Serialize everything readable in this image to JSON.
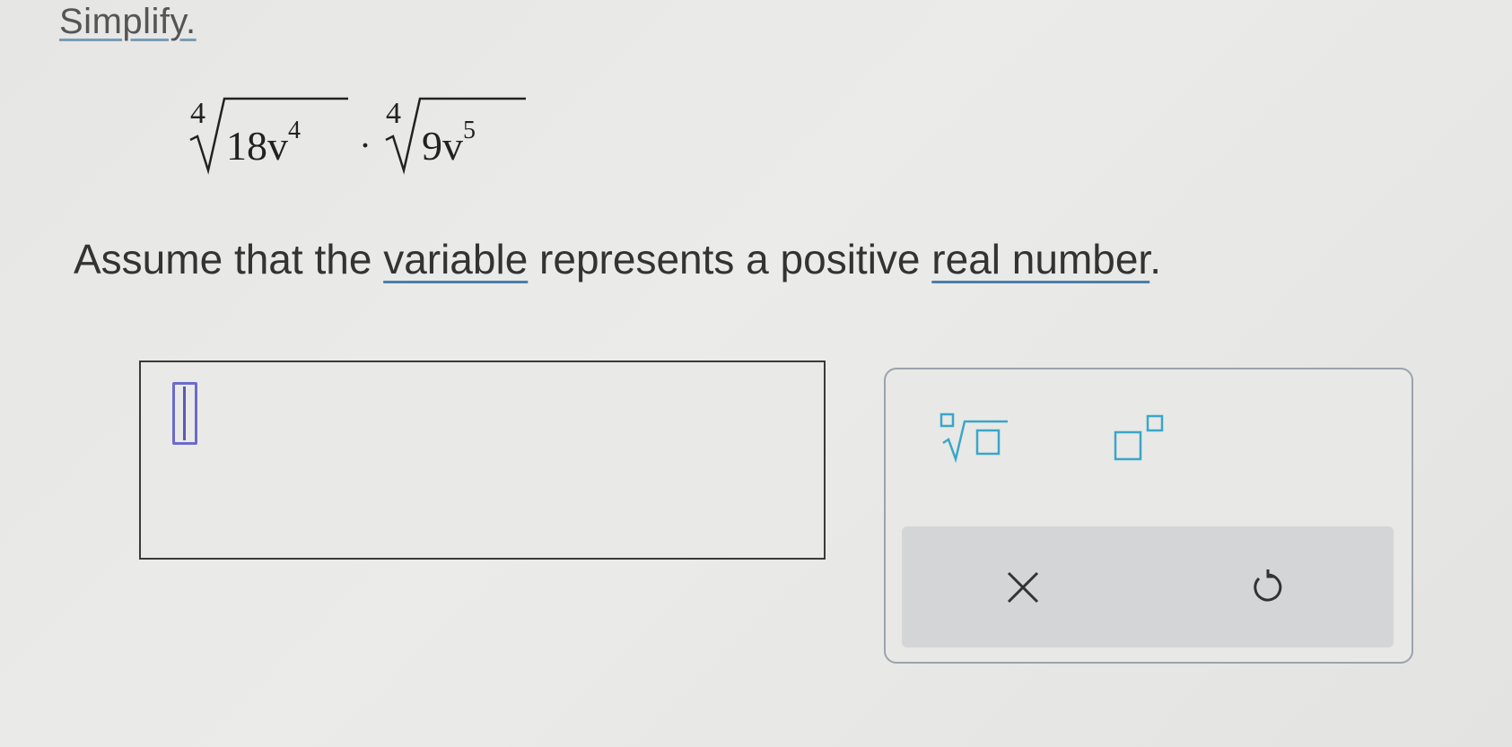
{
  "header": {
    "heading": "Simplify."
  },
  "problem": {
    "radicand1_base": "18v",
    "radicand1_exp": "4",
    "radicand2_base": "9v",
    "radicand2_exp": "5",
    "root_index": "4"
  },
  "prompt": {
    "before": "Assume that the ",
    "link1": "variable",
    "middle": " represents a positive ",
    "link2": "real number",
    "after": "."
  },
  "answer": {
    "value": ""
  },
  "palette": {
    "tools": [
      "nth-root-icon",
      "exponent-icon"
    ],
    "actions": [
      "close-icon",
      "undo-icon"
    ]
  },
  "colors": {
    "accent": "#3aa6c8",
    "link_underline": "#4a7fa8",
    "cursor": "#6b6bc9",
    "action_bar": "#d3d5d6"
  }
}
